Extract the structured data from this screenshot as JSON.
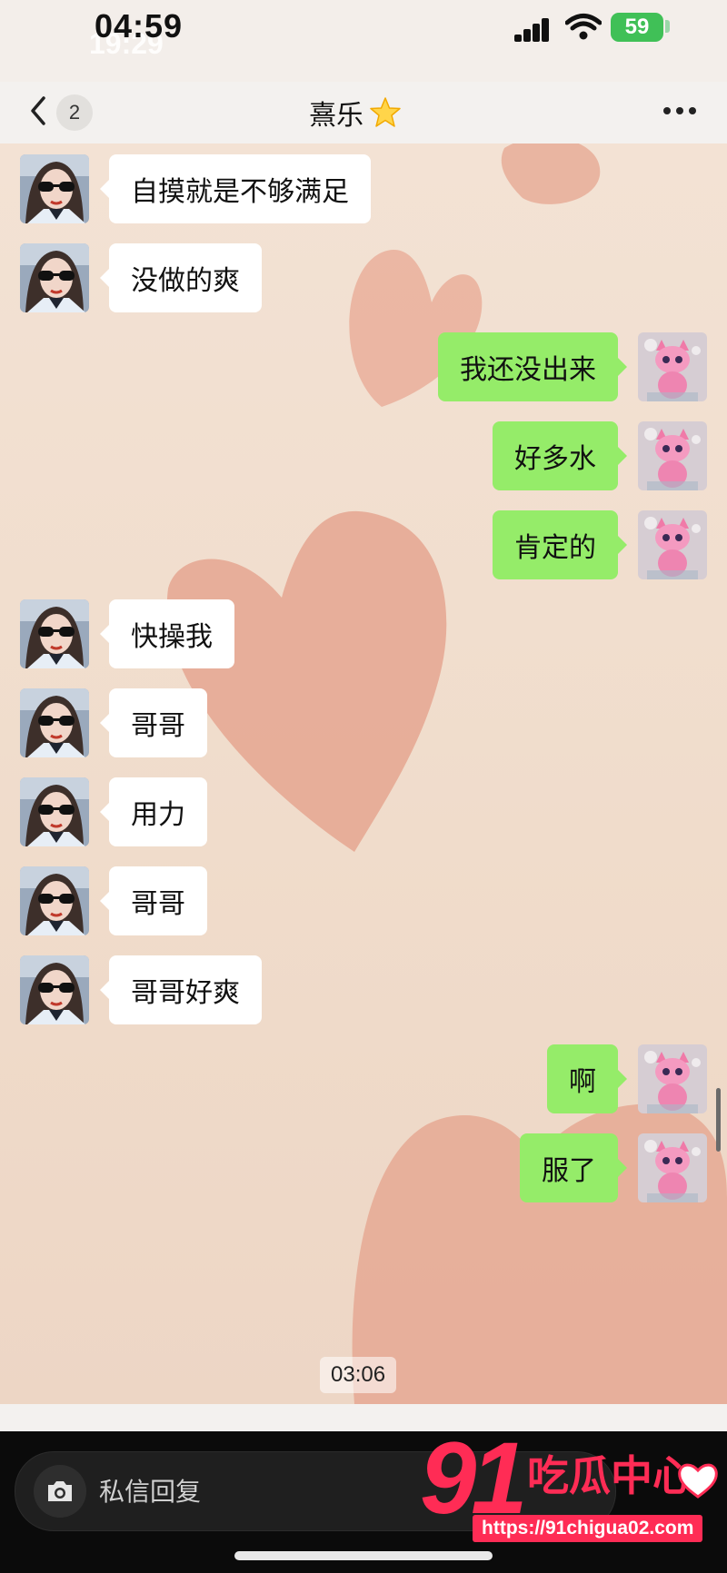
{
  "status_bar": {
    "time": "04:59",
    "time_ghost": "19:29",
    "battery": "59"
  },
  "header": {
    "back_count": "2",
    "title": "熹乐"
  },
  "messages": [
    {
      "side": "left",
      "text": "自摸就是不够满足"
    },
    {
      "side": "left",
      "text": "没做的爽"
    },
    {
      "side": "right",
      "text": "我还没出来"
    },
    {
      "side": "right",
      "text": "好多水"
    },
    {
      "side": "right",
      "text": "肯定的"
    },
    {
      "side": "left",
      "text": "快操我"
    },
    {
      "side": "left",
      "text": "哥哥"
    },
    {
      "side": "left",
      "text": "用力"
    },
    {
      "side": "left",
      "text": "哥哥"
    },
    {
      "side": "left",
      "text": "哥哥好爽"
    },
    {
      "side": "right",
      "text": "啊"
    },
    {
      "side": "right",
      "text": "服了"
    }
  ],
  "timestamp": "03:06",
  "reply": {
    "placeholder": "私信回复"
  },
  "watermark": {
    "number": "91",
    "name": "吃瓜中心",
    "url": "https://91chigua02.com"
  },
  "colors": {
    "sent_bubble": "#95ec69",
    "received_bubble": "#ffffff",
    "watermark": "#ff2c55"
  }
}
